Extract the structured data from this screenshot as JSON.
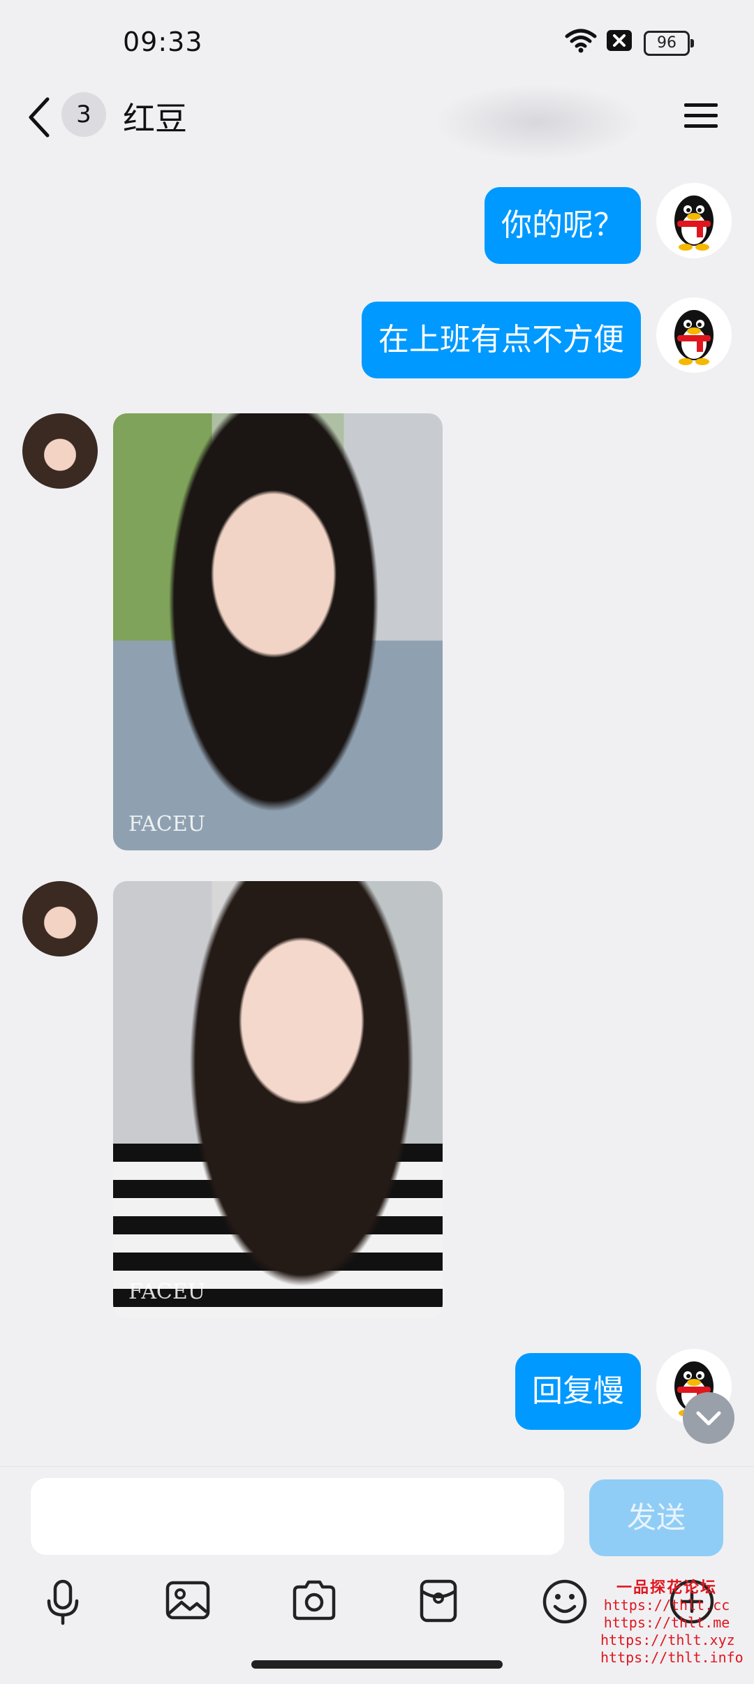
{
  "status_bar": {
    "time": "09:33",
    "battery": "96"
  },
  "header": {
    "unread_count": "3",
    "contact_name": "红豆"
  },
  "messages": [
    {
      "type": "text",
      "side": "right",
      "text": "你的呢？"
    },
    {
      "type": "text",
      "side": "right",
      "text": "在上班有点不方便"
    },
    {
      "type": "image",
      "side": "left",
      "watermark": "FACEU"
    },
    {
      "type": "image",
      "side": "left",
      "watermark": "FACEU"
    },
    {
      "type": "text",
      "side": "right",
      "text": "回复慢"
    }
  ],
  "input": {
    "placeholder": "",
    "send_label": "发送"
  },
  "toolbar": {
    "icons": [
      "microphone-icon",
      "image-icon",
      "camera-icon",
      "red-packet-icon",
      "emoji-icon",
      "plus-icon"
    ]
  },
  "watermark": {
    "title": "一品探花论坛",
    "urls": [
      "https://thlt.cc",
      "https://thlt.me",
      "https://thlt.xyz",
      "https://thlt.info"
    ]
  },
  "colors": {
    "bubble": "#0099ff",
    "send_disabled": "#8fcdf6",
    "background": "#f0f0f3"
  }
}
